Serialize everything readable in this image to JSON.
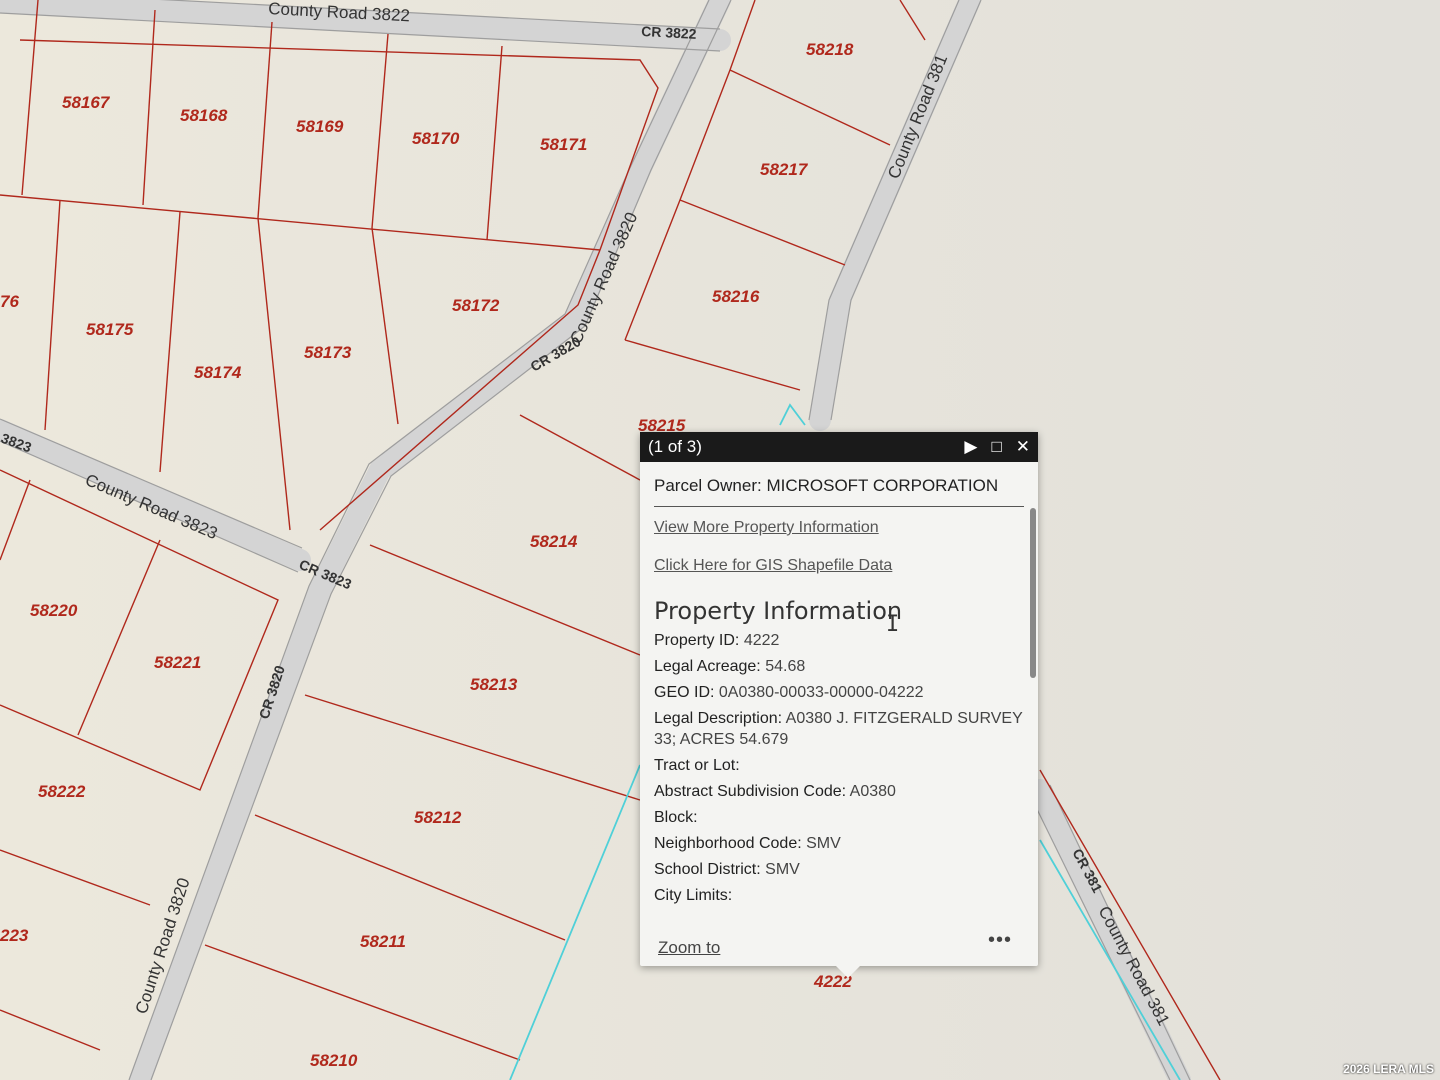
{
  "map": {
    "parcels": [
      {
        "id": "58167",
        "label": "58167"
      },
      {
        "id": "58168",
        "label": "58168"
      },
      {
        "id": "58169",
        "label": "58169"
      },
      {
        "id": "58170",
        "label": "58170"
      },
      {
        "id": "58171",
        "label": "58171"
      },
      {
        "id": "58218",
        "label": "58218"
      },
      {
        "id": "58217",
        "label": "58217"
      },
      {
        "id": "58216",
        "label": "58216"
      },
      {
        "id": "58172",
        "label": "58172"
      },
      {
        "id": "58173",
        "label": "58173"
      },
      {
        "id": "58174",
        "label": "58174"
      },
      {
        "id": "58175",
        "label": "58175"
      },
      {
        "id": "76",
        "label": "76"
      },
      {
        "id": "58215",
        "label": "58215"
      },
      {
        "id": "58214",
        "label": "58214"
      },
      {
        "id": "58213",
        "label": "58213"
      },
      {
        "id": "58212",
        "label": "58212"
      },
      {
        "id": "58211",
        "label": "58211"
      },
      {
        "id": "58210",
        "label": "58210"
      },
      {
        "id": "58220",
        "label": "58220"
      },
      {
        "id": "58221",
        "label": "58221"
      },
      {
        "id": "58222",
        "label": "58222"
      },
      {
        "id": "223",
        "label": "223"
      },
      {
        "id": "4222",
        "label": "4222"
      }
    ],
    "roads": {
      "county_road_3822": "County Road 3822",
      "cr_3822": "CR 3822",
      "county_road_3820_top": "County Road 3820",
      "cr_3820_mid": "CR 3820",
      "county_road_3823": "County Road 3823",
      "cr_3823": "CR 3823",
      "cr_3823_left": "3823",
      "cr_3820_low": "CR 3820",
      "county_road_3820_bottom": "County Road 3820",
      "county_road_381_top": "County Road 381",
      "cr_381": "CR 381",
      "county_road_381_bottom": "County Road 381"
    }
  },
  "popup": {
    "count": "(1 of 3)",
    "owner_label": "Parcel Owner:",
    "owner_value": "MICROSOFT CORPORATION",
    "link_more_info": "View More Property Information",
    "link_shapefile": "Click Here for GIS Shapefile Data",
    "section_title": "Property Information",
    "fields": [
      {
        "key": "Property ID:",
        "value": "4222"
      },
      {
        "key": "Legal Acreage:",
        "value": "54.68"
      },
      {
        "key": "GEO ID:",
        "value": "0A0380-00033-00000-04222"
      },
      {
        "key": "Legal Description:",
        "value": "A0380 J. FITZGERALD SURVEY 33; ACRES 54.679"
      },
      {
        "key": "Tract or Lot:",
        "value": ""
      },
      {
        "key": "Abstract Subdivision Code:",
        "value": "A0380"
      },
      {
        "key": "Block:",
        "value": ""
      },
      {
        "key": "Neighborhood Code:",
        "value": "SMV"
      },
      {
        "key": "School District:",
        "value": "SMV"
      },
      {
        "key": "City Limits:",
        "value": ""
      }
    ],
    "zoom_label": "Zoom to",
    "more_label": "•••",
    "play_icon": "▶",
    "maximize_icon": "□",
    "close_icon": "✕"
  },
  "watermark": "2026 LERA MLS",
  "colors": {
    "parcel_line": "#b0281c",
    "road_fill": "#d9d9d9",
    "selection": "#4fd0d8",
    "header_bg": "#1a1a1a"
  }
}
